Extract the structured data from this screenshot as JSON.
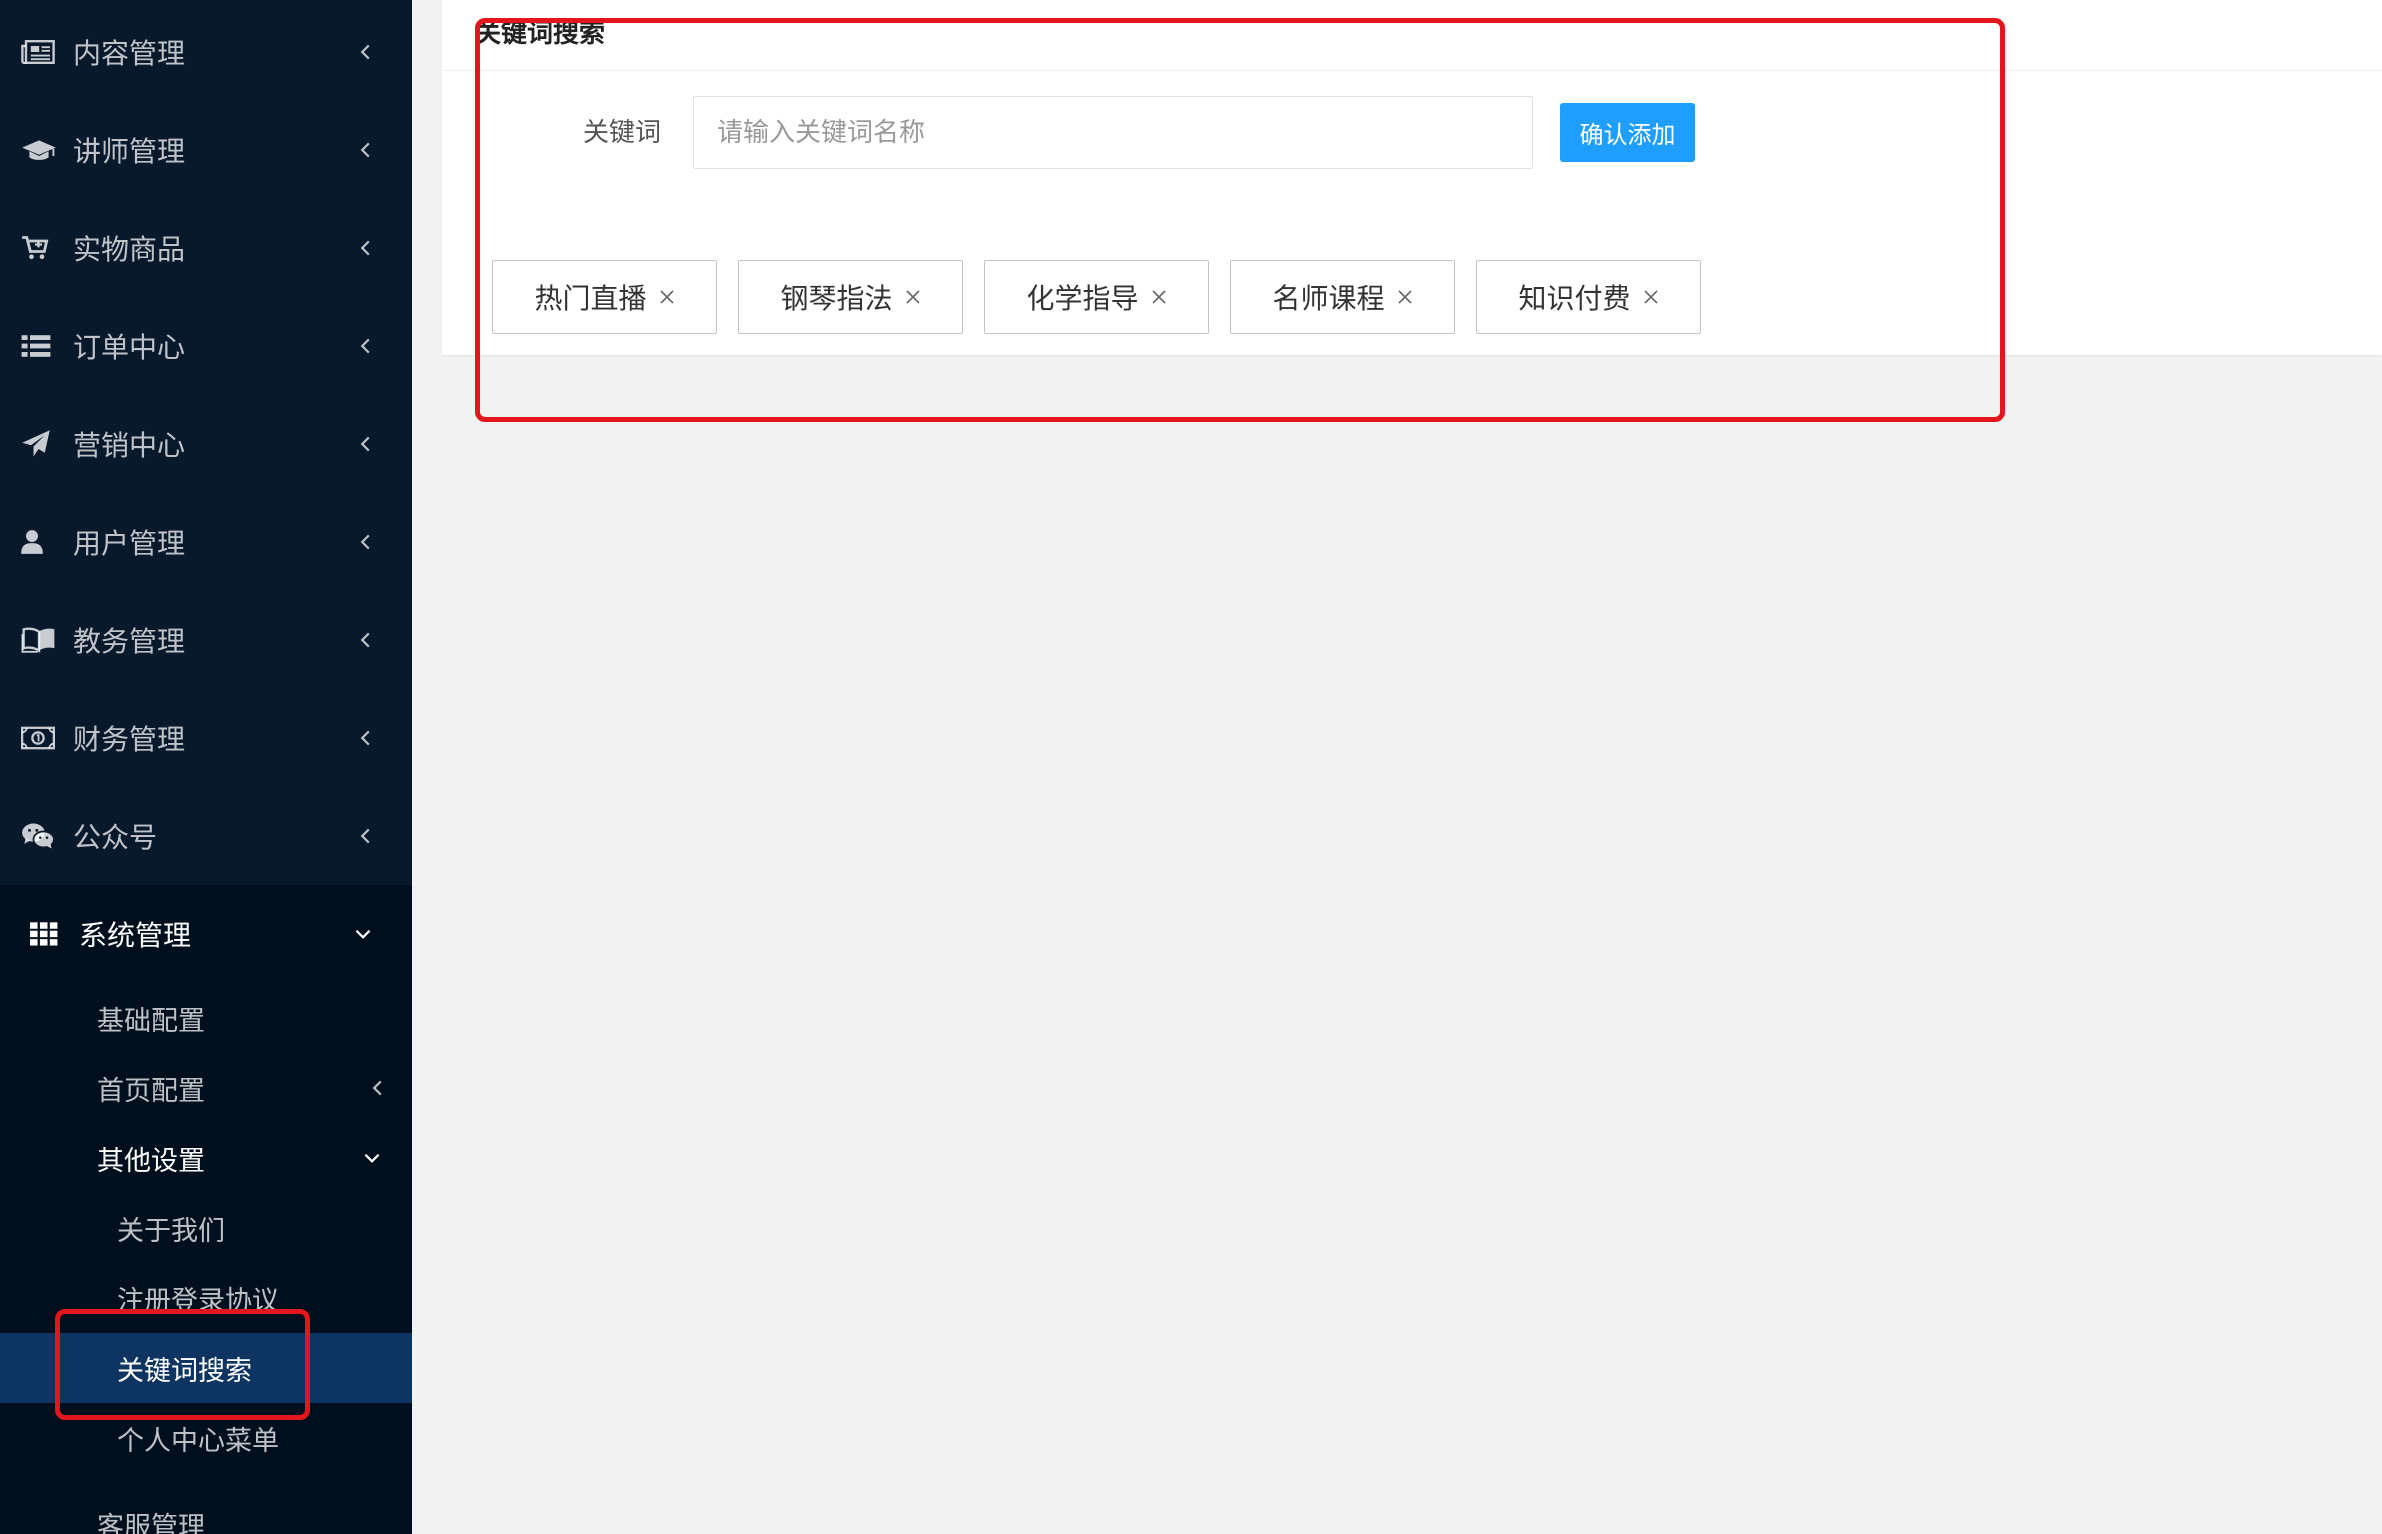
{
  "sidebar": {
    "items": [
      {
        "label": "内容管理",
        "icon": "newspaper-icon"
      },
      {
        "label": "讲师管理",
        "icon": "graduation-cap-icon"
      },
      {
        "label": "实物商品",
        "icon": "cart-icon"
      },
      {
        "label": "订单中心",
        "icon": "list-icon"
      },
      {
        "label": "营销中心",
        "icon": "paper-plane-icon"
      },
      {
        "label": "用户管理",
        "icon": "user-icon"
      },
      {
        "label": "教务管理",
        "icon": "book-icon"
      },
      {
        "label": "财务管理",
        "icon": "money-icon"
      },
      {
        "label": "公众号",
        "icon": "wechat-icon"
      },
      {
        "label": "系统管理",
        "icon": "grid-icon",
        "expanded": true
      }
    ],
    "system_menu": [
      {
        "label": "基础配置"
      },
      {
        "label": "首页配置",
        "expanded": false
      },
      {
        "label": "其他设置",
        "expanded": true
      },
      {
        "label": "客服管理"
      }
    ],
    "other_settings": [
      {
        "label": "关于我们"
      },
      {
        "label": "注册登录协议"
      },
      {
        "label": "关键词搜索",
        "selected": true
      },
      {
        "label": "个人中心菜单"
      }
    ]
  },
  "main": {
    "card_title": "关键词搜索",
    "form": {
      "label": "关键词",
      "placeholder": "请输入关键词名称",
      "value": "",
      "submit_label": "确认添加"
    },
    "tags": [
      {
        "label": "热门直播",
        "icon": "close-icon"
      },
      {
        "label": "钢琴指法",
        "icon": "close-icon"
      },
      {
        "label": "化学指导",
        "icon": "close-icon"
      },
      {
        "label": "名师课程",
        "icon": "close-icon"
      },
      {
        "label": "知识付费",
        "icon": "close-icon"
      }
    ]
  },
  "colors": {
    "primary": "#1E9FFF",
    "sidebar": "#08192C",
    "sidebar_open": "#000F1D",
    "selected": "#0E3461",
    "annotation": "#E3161E"
  }
}
